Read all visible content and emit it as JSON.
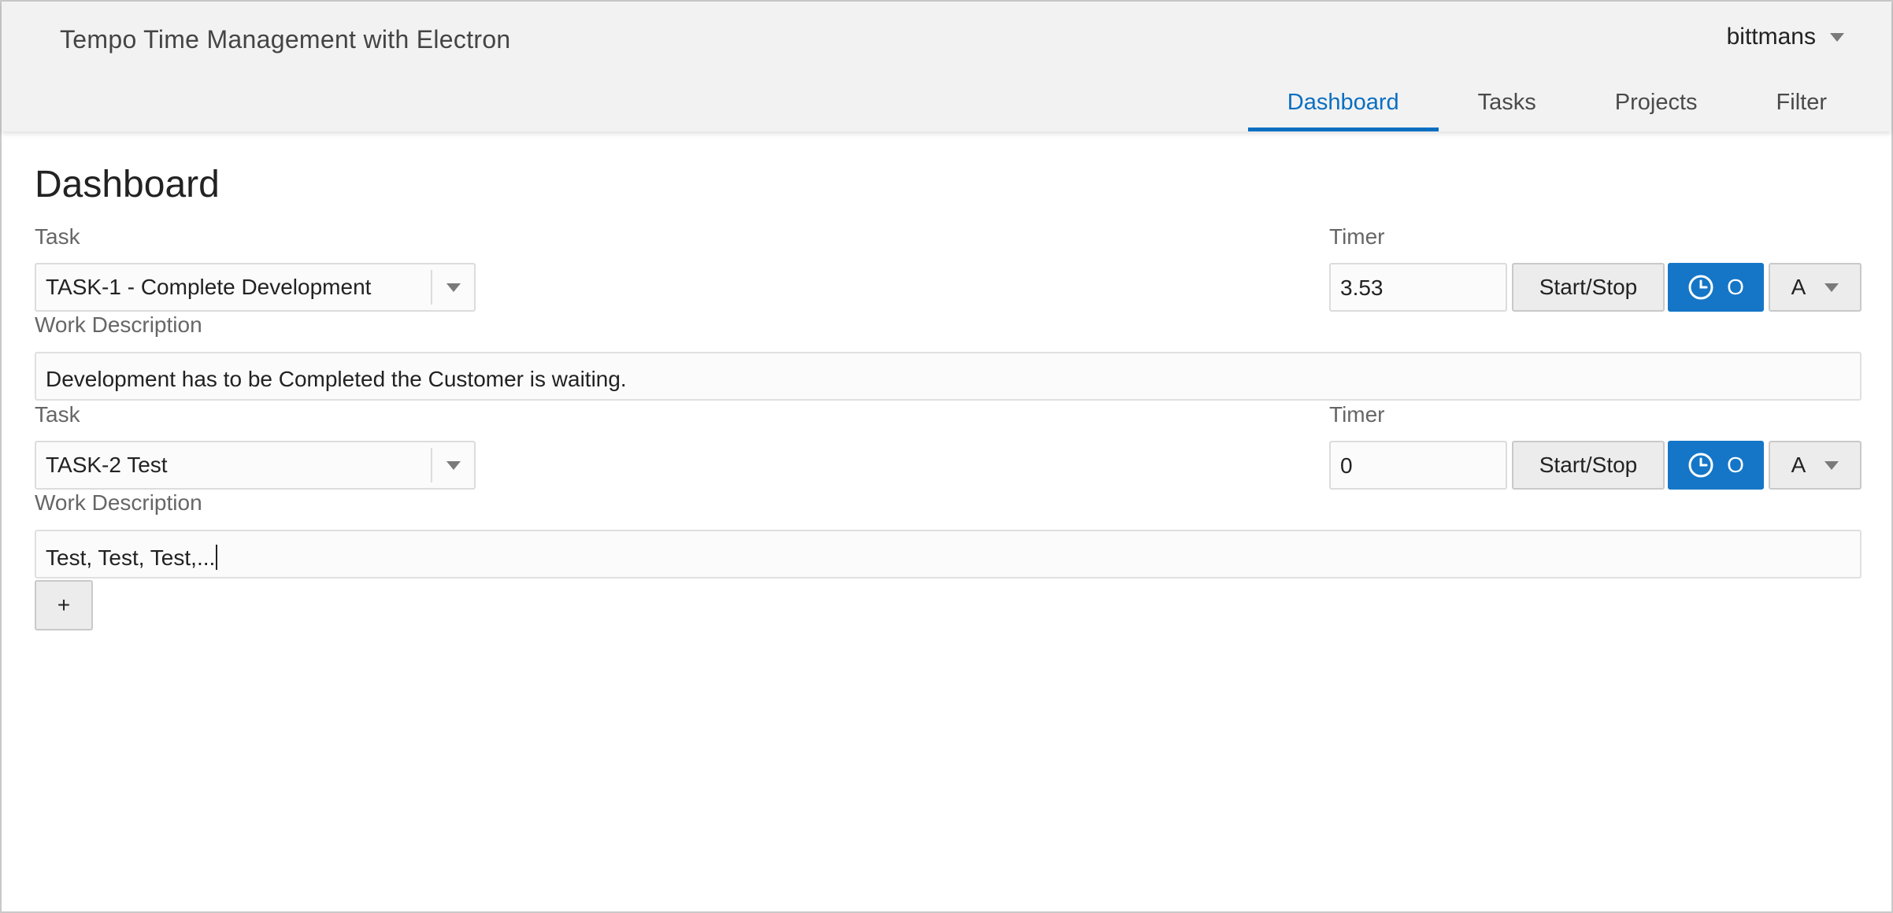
{
  "app": {
    "title": "Tempo Time Management with Electron",
    "user": "bittmans"
  },
  "nav": {
    "tabs": [
      {
        "label": "Dashboard",
        "active": true
      },
      {
        "label": "Tasks",
        "active": false
      },
      {
        "label": "Projects",
        "active": false
      },
      {
        "label": "Filter",
        "active": false
      }
    ]
  },
  "main": {
    "title": "Dashboard",
    "entries": [
      {
        "task_label": "Task",
        "task_value": "TASK-1 - Complete Development",
        "timer_label": "Timer",
        "timer_value": "3.53",
        "start_stop_label": "Start/Stop",
        "clock_button_label": "O",
        "mode_label": "A",
        "desc_label": "Work Description",
        "desc_value": "Development has to be Completed the Customer is waiting."
      },
      {
        "task_label": "Task",
        "task_value": "TASK-2 Test",
        "timer_label": "Timer",
        "timer_value": "0",
        "start_stop_label": "Start/Stop",
        "clock_button_label": "O",
        "mode_label": "A",
        "desc_label": "Work Description",
        "desc_value": "Test, Test, Test,..."
      }
    ],
    "add_label": "+"
  },
  "colors": {
    "accent": "#1576c7",
    "active_tab": "#0a6fc2",
    "header_bg": "#f2f2f2"
  },
  "icons": {
    "user_dropdown": "chevron-down-icon",
    "clock": "clock-icon",
    "select_arrow": "caret-down-icon"
  }
}
